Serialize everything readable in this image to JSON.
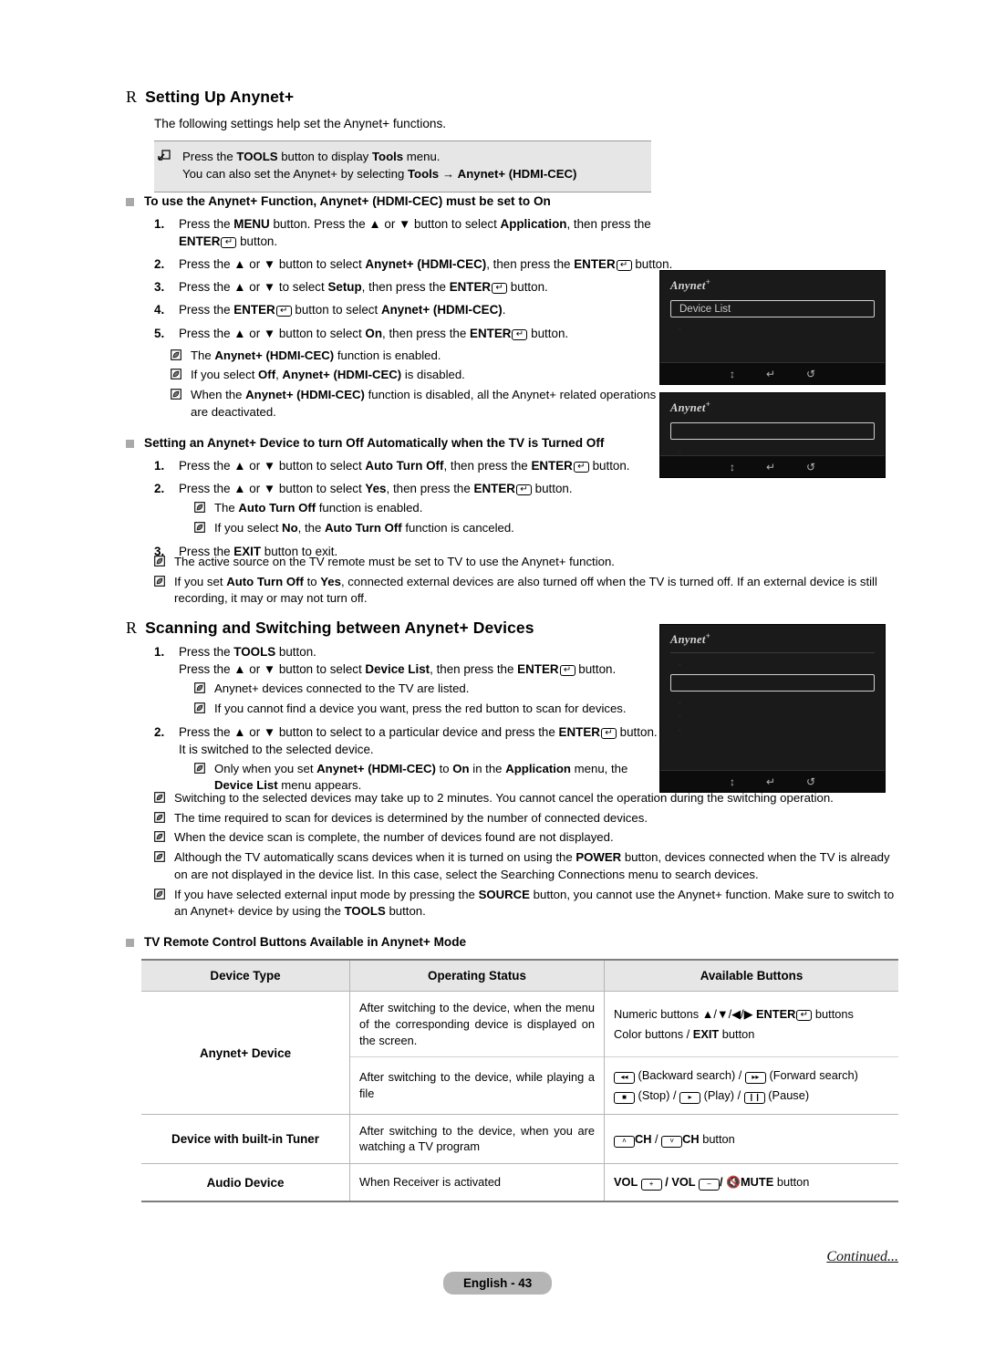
{
  "document": {
    "page_label": "English - 43",
    "continued_label": "Continued...",
    "section_marker": "R"
  },
  "section1": {
    "heading": "Setting Up Anynet+",
    "lead": "The following settings help set the Anynet+ functions.",
    "tools_note": {
      "icon": "tools-icon",
      "line1_parts": [
        "Press the ",
        "TOOLS",
        " button to display ",
        "Tools",
        " menu."
      ],
      "line2_parts": [
        "You can also set the Anynet+ by selecting ",
        "Tools",
        " ",
        "→",
        " ",
        "Anynet+ (HDMI-CEC)"
      ]
    },
    "sub1": {
      "heading": "To use the Anynet+ Function, Anynet+ (HDMI-CEC) must be set to On",
      "steps": [
        {
          "num": "1.",
          "parts": [
            {
              "t": "Press the ",
              "b": false
            },
            {
              "t": "MENU",
              "b": true
            },
            {
              "t": " button. Press the ▲ or ▼ button to select ",
              "b": false
            },
            {
              "t": "Application",
              "b": true
            },
            {
              "t": ", then press the ",
              "b": false
            },
            {
              "t": "ENTER",
              "b": true
            },
            {
              "t": "__KEY__",
              "b": false
            },
            {
              "t": " button.",
              "b": false
            }
          ]
        },
        {
          "num": "2.",
          "parts": [
            {
              "t": "Press the ▲ or ▼ button to select ",
              "b": false
            },
            {
              "t": "Anynet+ (HDMI-CEC)",
              "b": true
            },
            {
              "t": ", then press the ",
              "b": false
            },
            {
              "t": "ENTER",
              "b": true
            },
            {
              "t": "__KEY__",
              "b": false
            },
            {
              "t": " button.",
              "b": false
            }
          ]
        },
        {
          "num": "3.",
          "parts": [
            {
              "t": "Press the  ▲ or ▼  to select ",
              "b": false
            },
            {
              "t": "Setup",
              "b": true
            },
            {
              "t": ", then press the ",
              "b": false
            },
            {
              "t": "ENTER",
              "b": true
            },
            {
              "t": "__KEY__",
              "b": false
            },
            {
              "t": " button.",
              "b": false
            }
          ]
        },
        {
          "num": "4.",
          "parts": [
            {
              "t": "Press the ",
              "b": false
            },
            {
              "t": "ENTER",
              "b": true
            },
            {
              "t": "__KEY__",
              "b": false
            },
            {
              "t": " button to select ",
              "b": false
            },
            {
              "t": "Anynet+ (HDMI-CEC)",
              "b": true
            },
            {
              "t": ".",
              "b": false
            }
          ]
        },
        {
          "num": "5.",
          "parts": [
            {
              "t": "Press the ▲ or ▼ button to select ",
              "b": false
            },
            {
              "t": "On",
              "b": true
            },
            {
              "t": ", then press the ",
              "b": false
            },
            {
              "t": "ENTER",
              "b": true
            },
            {
              "t": "__KEY__",
              "b": false
            },
            {
              "t": " button.",
              "b": false
            }
          ]
        }
      ],
      "notes": [
        [
          {
            "t": "The ",
            "b": false
          },
          {
            "t": "Anynet+ (HDMI-CEC)",
            "b": true
          },
          {
            "t": " function is enabled.",
            "b": false
          }
        ],
        [
          {
            "t": "If you select ",
            "b": false
          },
          {
            "t": "Off",
            "b": true
          },
          {
            "t": ", ",
            "b": false
          },
          {
            "t": "Anynet+ (HDMI-CEC)",
            "b": true
          },
          {
            "t": " is disabled.",
            "b": false
          }
        ],
        [
          {
            "t": "When the ",
            "b": false
          },
          {
            "t": "Anynet+ (HDMI-CEC)",
            "b": true
          },
          {
            "t": " function is disabled, all the Anynet+ related operations are deactivated.",
            "b": false
          }
        ]
      ]
    },
    "sub2": {
      "heading": "Setting an Anynet+ Device to turn Off Automatically when the TV is Turned Off",
      "steps": [
        {
          "num": "1.",
          "parts": [
            {
              "t": "Press the ▲ or ▼ button to select ",
              "b": false
            },
            {
              "t": "Auto Turn Off",
              "b": true
            },
            {
              "t": ", then press the ",
              "b": false
            },
            {
              "t": "ENTER",
              "b": true
            },
            {
              "t": "__KEY__",
              "b": false
            },
            {
              "t": " button.",
              "b": false
            }
          ]
        },
        {
          "num": "2.",
          "parts": [
            {
              "t": "Press the ▲ or ▼ button to select ",
              "b": false
            },
            {
              "t": "Yes",
              "b": true
            },
            {
              "t": ", then press the ",
              "b": false
            },
            {
              "t": "ENTER",
              "b": true
            },
            {
              "t": "__KEY__",
              "b": false
            },
            {
              "t": " button.",
              "b": false
            }
          ]
        }
      ],
      "step2_notes": [
        [
          {
            "t": "The ",
            "b": false
          },
          {
            "t": "Auto Turn Off",
            "b": true
          },
          {
            "t": " function is enabled.",
            "b": false
          }
        ],
        [
          {
            "t": "If you select ",
            "b": false
          },
          {
            "t": "No",
            "b": true
          },
          {
            "t": ", the ",
            "b": false
          },
          {
            "t": "Auto Turn Off",
            "b": true
          },
          {
            "t": " function is canceled.",
            "b": false
          }
        ]
      ],
      "step3": {
        "num": "3.",
        "parts": [
          {
            "t": "Press the ",
            "b": false
          },
          {
            "t": "EXIT",
            "b": true
          },
          {
            "t": " button to exit.",
            "b": false
          }
        ]
      },
      "notes": [
        [
          {
            "t": "The active source on the TV remote must be set to TV to use the Anynet+ function.",
            "b": false
          }
        ],
        [
          {
            "t": "If you set ",
            "b": false
          },
          {
            "t": "Auto Turn Off",
            "b": true
          },
          {
            "t": " to ",
            "b": false
          },
          {
            "t": "Yes",
            "b": true
          },
          {
            "t": ", connected external devices are also turned off when the TV is turned off. If an external device is still recording, it may or may not turn off.",
            "b": false
          }
        ]
      ]
    }
  },
  "section2": {
    "heading": "Scanning and Switching between Anynet+ Devices",
    "steps": [
      {
        "num": "1.",
        "parts": [
          {
            "t": "Press the ",
            "b": false
          },
          {
            "t": "TOOLS",
            "b": true
          },
          {
            "t": " button.",
            "b": false
          },
          {
            "t": "__BR__",
            "b": false
          },
          {
            "t": "Press the ▲ or ▼ button to select ",
            "b": false
          },
          {
            "t": "Device List",
            "b": true
          },
          {
            "t": ", then press the ",
            "b": false
          },
          {
            "t": "ENTER",
            "b": true
          },
          {
            "t": "__KEY__",
            "b": false
          },
          {
            "t": " button.",
            "b": false
          }
        ],
        "notes": [
          [
            {
              "t": "Anynet+ devices connected to the TV are listed.",
              "b": false
            }
          ],
          [
            {
              "t": "If you cannot find a device you want, press the red button to scan for devices.",
              "b": false
            }
          ]
        ]
      },
      {
        "num": "2.",
        "parts": [
          {
            "t": "Press the ▲ or ▼ button to select to a particular device and press the ",
            "b": false
          },
          {
            "t": "ENTER",
            "b": true
          },
          {
            "t": "__KEY__",
            "b": false
          },
          {
            "t": " button. It is switched to the selected device.",
            "b": false
          }
        ],
        "notes": [
          [
            {
              "t": "Only when you set ",
              "b": false
            },
            {
              "t": "Anynet+ (HDMI-CEC)",
              "b": true
            },
            {
              "t": " to ",
              "b": false
            },
            {
              "t": "On",
              "b": true
            },
            {
              "t": " in the ",
              "b": false
            },
            {
              "t": "Application",
              "b": true
            },
            {
              "t": " menu, the ",
              "b": false
            },
            {
              "t": "Device List",
              "b": true
            },
            {
              "t": " menu appears.",
              "b": false
            }
          ]
        ]
      }
    ],
    "notes": [
      [
        {
          "t": "Switching to the selected devices may take up to 2 minutes. You cannot cancel the operation during the switching operation.",
          "b": false
        }
      ],
      [
        {
          "t": "The time required to scan for devices is determined by the number of connected devices.",
          "b": false
        }
      ],
      [
        {
          "t": "When the device scan is complete, the number of devices found are not displayed.",
          "b": false
        }
      ],
      [
        {
          "t": "Although the TV automatically scans devices when it is turned on using the ",
          "b": false
        },
        {
          "t": "POWER",
          "b": true
        },
        {
          "t": " button, devices connected when the TV is already on are not displayed in the device list. In this case, select the Searching Connections menu to search devices.",
          "b": false
        }
      ],
      [
        {
          "t": "If you have selected external input mode by pressing the ",
          "b": false
        },
        {
          "t": "SOURCE",
          "b": true
        },
        {
          "t": " button, you cannot use the Anynet+ function. Make sure to switch to an Anynet+ device by using the ",
          "b": false
        },
        {
          "t": "TOOLS",
          "b": true
        },
        {
          "t": " button.",
          "b": false
        }
      ]
    ]
  },
  "table_section": {
    "heading": "TV Remote Control Buttons Available in Anynet+ Mode",
    "columns": [
      "Device Type",
      "Operating Status",
      "Available Buttons"
    ],
    "rows": [
      {
        "device": "Anynet+ Device",
        "device_rowspan": 2,
        "status": "After switching to the device, when the menu of the corresponding device is displayed on the screen.",
        "buttons_lines": [
          [
            {
              "t": "Numeric buttons  ▲/▼/◀/▶  ",
              "b": false
            },
            {
              "t": "ENTER",
              "b": true
            },
            {
              "t": "__KEY__",
              "b": false
            },
            {
              "t": "  buttons",
              "b": false
            }
          ],
          [
            {
              "t": "Color buttons / ",
              "b": false
            },
            {
              "t": "EXIT",
              "b": true
            },
            {
              "t": " button",
              "b": false
            }
          ]
        ]
      },
      {
        "device": "",
        "status": "After switching to the device, while playing a file",
        "buttons_lines": [
          [
            {
              "t": "__BTN:◂◂__",
              "b": false
            },
            {
              "t": " (Backward search) / ",
              "b": false
            },
            {
              "t": "__BTN:▸▸__",
              "b": false
            },
            {
              "t": " (Forward search)",
              "b": false
            }
          ],
          [
            {
              "t": "__BTN:■__",
              "b": false
            },
            {
              "t": " (Stop) / ",
              "b": false
            },
            {
              "t": "__BTN:▸__",
              "b": false
            },
            {
              "t": " (Play) / ",
              "b": false
            },
            {
              "t": "__BTN:❙❙__",
              "b": false
            },
            {
              "t": " (Pause)",
              "b": false
            }
          ]
        ]
      },
      {
        "device": "Device with built-in Tuner",
        "status": "After switching to the device, when you are watching a TV program",
        "buttons_lines": [
          [
            {
              "t": "__BTN:˄__",
              "b": false
            },
            {
              "t": "CH",
              "b": true
            },
            {
              "t": " / ",
              "b": false
            },
            {
              "t": "__BTN:˅__",
              "b": false
            },
            {
              "t": "CH",
              "b": true
            },
            {
              "t": " button",
              "b": false
            }
          ]
        ]
      },
      {
        "device": "Audio Device",
        "status": "When Receiver is activated",
        "buttons_lines": [
          [
            {
              "t": "VOL ",
              "b": true
            },
            {
              "t": "__BTN:+__",
              "b": false
            },
            {
              "t": " / ",
              "b": true
            },
            {
              "t": "VOL ",
              "b": true
            },
            {
              "t": "__BTN:–__",
              "b": false
            },
            {
              "t": "/ ",
              "b": true
            },
            {
              "t": "🔇",
              "b": false
            },
            {
              "t": "MUTE",
              "b": true
            },
            {
              "t": " button",
              "b": false
            }
          ]
        ]
      }
    ]
  },
  "tv_screens": [
    {
      "id": "tv-anynet-device-list",
      "logo": "Anynet",
      "logo_sup": "+",
      "highlight": "Device List",
      "ghost_lines": [
        "·"
      ],
      "bar_icons": [
        "move-icon",
        "enter-icon",
        "return-icon"
      ]
    },
    {
      "id": "tv-anynet-setup",
      "logo": "Anynet",
      "logo_sup": "+",
      "highlight": "",
      "ghost_lines": [
        "·",
        "·"
      ],
      "bar_icons": [
        "move-icon",
        "enter-icon",
        "return-icon"
      ]
    },
    {
      "id": "tv-anynet-device-browse",
      "logo": "Anynet",
      "logo_sup": "+",
      "highlight": "",
      "ghost_lines": [
        "·",
        "·",
        "·",
        "·",
        "·",
        "·"
      ],
      "bar_icons": [
        "move-icon",
        "enter-icon",
        "return-icon"
      ]
    }
  ]
}
